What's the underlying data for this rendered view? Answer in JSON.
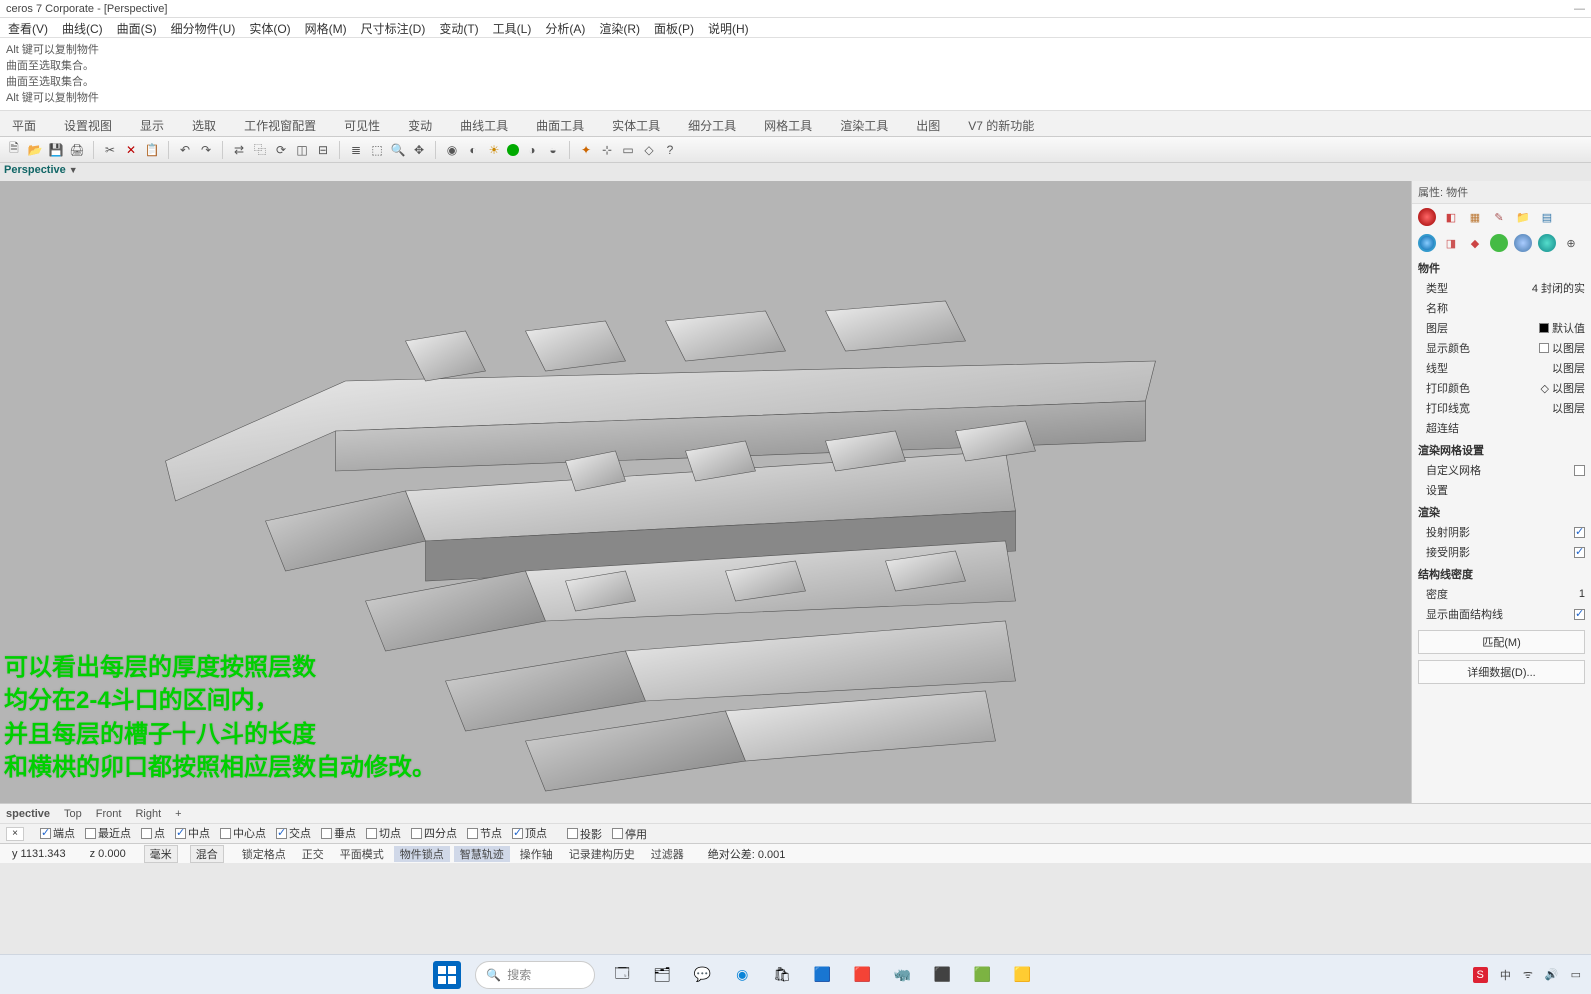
{
  "title": "ceros 7 Corporate - [Perspective]",
  "menus": [
    "查看(V)",
    "曲线(C)",
    "曲面(S)",
    "细分物件(U)",
    "实体(O)",
    "网格(M)",
    "尺寸标注(D)",
    "变动(T)",
    "工具(L)",
    "分析(A)",
    "渲染(R)",
    "面板(P)",
    "说明(H)"
  ],
  "history": [
    "Alt 键可以复制物件",
    "曲面至选取集合。",
    "曲面至选取集合。",
    "Alt 键可以复制物件"
  ],
  "tabs": [
    "平面",
    "设置视图",
    "显示",
    "选取",
    "工作视窗配置",
    "可见性",
    "变动",
    "曲线工具",
    "曲面工具",
    "实体工具",
    "细分工具",
    "网格工具",
    "渲染工具",
    "出图",
    "V7 的新功能"
  ],
  "viewport_name": "Perspective",
  "overlay_lines": [
    "可以看出每层的厚度按照层数",
    "均分在2-4斗口的区间内，",
    "并且每层的槽子十八斗的长度",
    "和横栱的卯口都按照相应层数自动修改。"
  ],
  "right": {
    "panel_title": "属性: 物件",
    "sections": {
      "object": "物件",
      "render_mesh": "渲染网格设置",
      "render": "渲染",
      "iso": "结构线密度"
    },
    "rows": {
      "type": {
        "label": "类型",
        "value": "4 封闭的实"
      },
      "name": {
        "label": "名称",
        "value": ""
      },
      "layer": {
        "label": "图层",
        "value": "默认值"
      },
      "disp_color": {
        "label": "显示颜色",
        "value": "以图层"
      },
      "linetype": {
        "label": "线型",
        "value": "以图层"
      },
      "print_color": {
        "label": "打印颜色",
        "value": "以图层"
      },
      "print_width": {
        "label": "打印线宽",
        "value": "以图层"
      },
      "hyperlink": {
        "label": "超连结",
        "value": ""
      },
      "custom_mesh": {
        "label": "自定义网格"
      },
      "settings": {
        "label": "设置"
      },
      "cast": {
        "label": "投射阴影"
      },
      "recv": {
        "label": "接受阴影"
      },
      "density": {
        "label": "密度",
        "value": "1"
      },
      "show_iso": {
        "label": "显示曲面结构线"
      }
    },
    "buttons": {
      "match": "匹配(M)",
      "details": "详细数据(D)..."
    }
  },
  "view_tabs": [
    "spective",
    "Top",
    "Front",
    "Right",
    "+"
  ],
  "osnaps": {
    "items": [
      {
        "label": "端点",
        "on": true
      },
      {
        "label": "最近点",
        "on": false
      },
      {
        "label": "点",
        "on": false
      },
      {
        "label": "中点",
        "on": true
      },
      {
        "label": "中心点",
        "on": false
      },
      {
        "label": "交点",
        "on": true
      },
      {
        "label": "垂点",
        "on": false
      },
      {
        "label": "切点",
        "on": false
      },
      {
        "label": "四分点",
        "on": false
      },
      {
        "label": "节点",
        "on": false
      },
      {
        "label": "顶点",
        "on": true
      }
    ],
    "proj": "投影",
    "disable": "停用"
  },
  "status": {
    "coords_y": "y 1131.343",
    "coords_z": "z 0.000",
    "unit": "毫米",
    "layer": "混合",
    "toggles": [
      "锁定格点",
      "正交",
      "平面模式",
      "物件锁点",
      "智慧轨迹",
      "操作轴",
      "记录建构历史",
      "过滤器"
    ],
    "active": [
      "物件锁点",
      "智慧轨迹"
    ],
    "tol": "绝对公差: 0.001"
  },
  "taskbar": {
    "search_placeholder": "搜索",
    "ime": "中"
  }
}
